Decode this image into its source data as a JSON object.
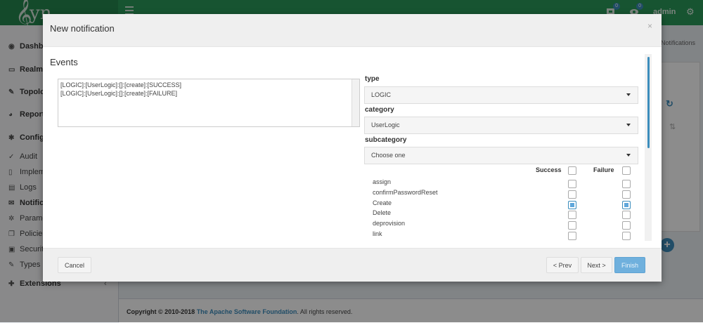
{
  "app": {
    "brand": "yn",
    "admin_label": "admin",
    "badges": [
      "0",
      "0"
    ],
    "accent_color": "#3c8dbc",
    "header_color": "#2a9a5a"
  },
  "sidebar": {
    "items": [
      {
        "label": "Dashbo",
        "icon": "dashboard-icon"
      },
      {
        "label": "Realms",
        "icon": "folder-icon"
      },
      {
        "label": "Topolo",
        "icon": "wrench-icon"
      },
      {
        "label": "Reports",
        "icon": "pie-chart-icon"
      },
      {
        "label": "Configu",
        "icon": "cogs-icon"
      },
      {
        "label": "Audit",
        "icon": "check-icon"
      },
      {
        "label": "Implem",
        "icon": "file-icon"
      },
      {
        "label": "Logs",
        "icon": "file-text-icon"
      },
      {
        "label": "Notifica",
        "icon": "envelope-icon"
      },
      {
        "label": "Parame",
        "icon": "cog-icon"
      },
      {
        "label": "Policies",
        "icon": "copy-icon"
      },
      {
        "label": "Security",
        "icon": "lock-icon"
      },
      {
        "label": "Types",
        "icon": "wrench-icon"
      },
      {
        "label": "Extensions",
        "icon": "puzzle-icon"
      }
    ]
  },
  "content": {
    "breadcrumb_tail": "Notifications"
  },
  "footer": {
    "copyright": "Copyright © 2010-2018",
    "org": "The Apache Software Foundation",
    "rights": ". All rights reserved."
  },
  "modal": {
    "title": "New notification",
    "close": "×",
    "events_title": "Events",
    "events": [
      "[LOGIC]:[UserLogic]:[]:[create]:[SUCCESS]",
      "[LOGIC]:[UserLogic]:[]:[create]:[FAILURE]"
    ],
    "type_label": "type",
    "type_value": "LOGIC",
    "category_label": "category",
    "category_value": "UserLogic",
    "subcategory_label": "subcategory",
    "subcategory_value": "Choose one",
    "success_label": "Success",
    "failure_label": "Failure",
    "operations": [
      {
        "name": "assign",
        "success": false,
        "failure": false
      },
      {
        "name": "confirmPasswordReset",
        "success": false,
        "failure": false
      },
      {
        "name": "Create",
        "success": true,
        "failure": true
      },
      {
        "name": "Delete",
        "success": false,
        "failure": false
      },
      {
        "name": "deprovision",
        "success": false,
        "failure": false
      },
      {
        "name": "link",
        "success": false,
        "failure": false
      }
    ],
    "buttons": {
      "cancel": "Cancel",
      "prev": "< Prev",
      "next": "Next >",
      "finish": "Finish"
    }
  }
}
